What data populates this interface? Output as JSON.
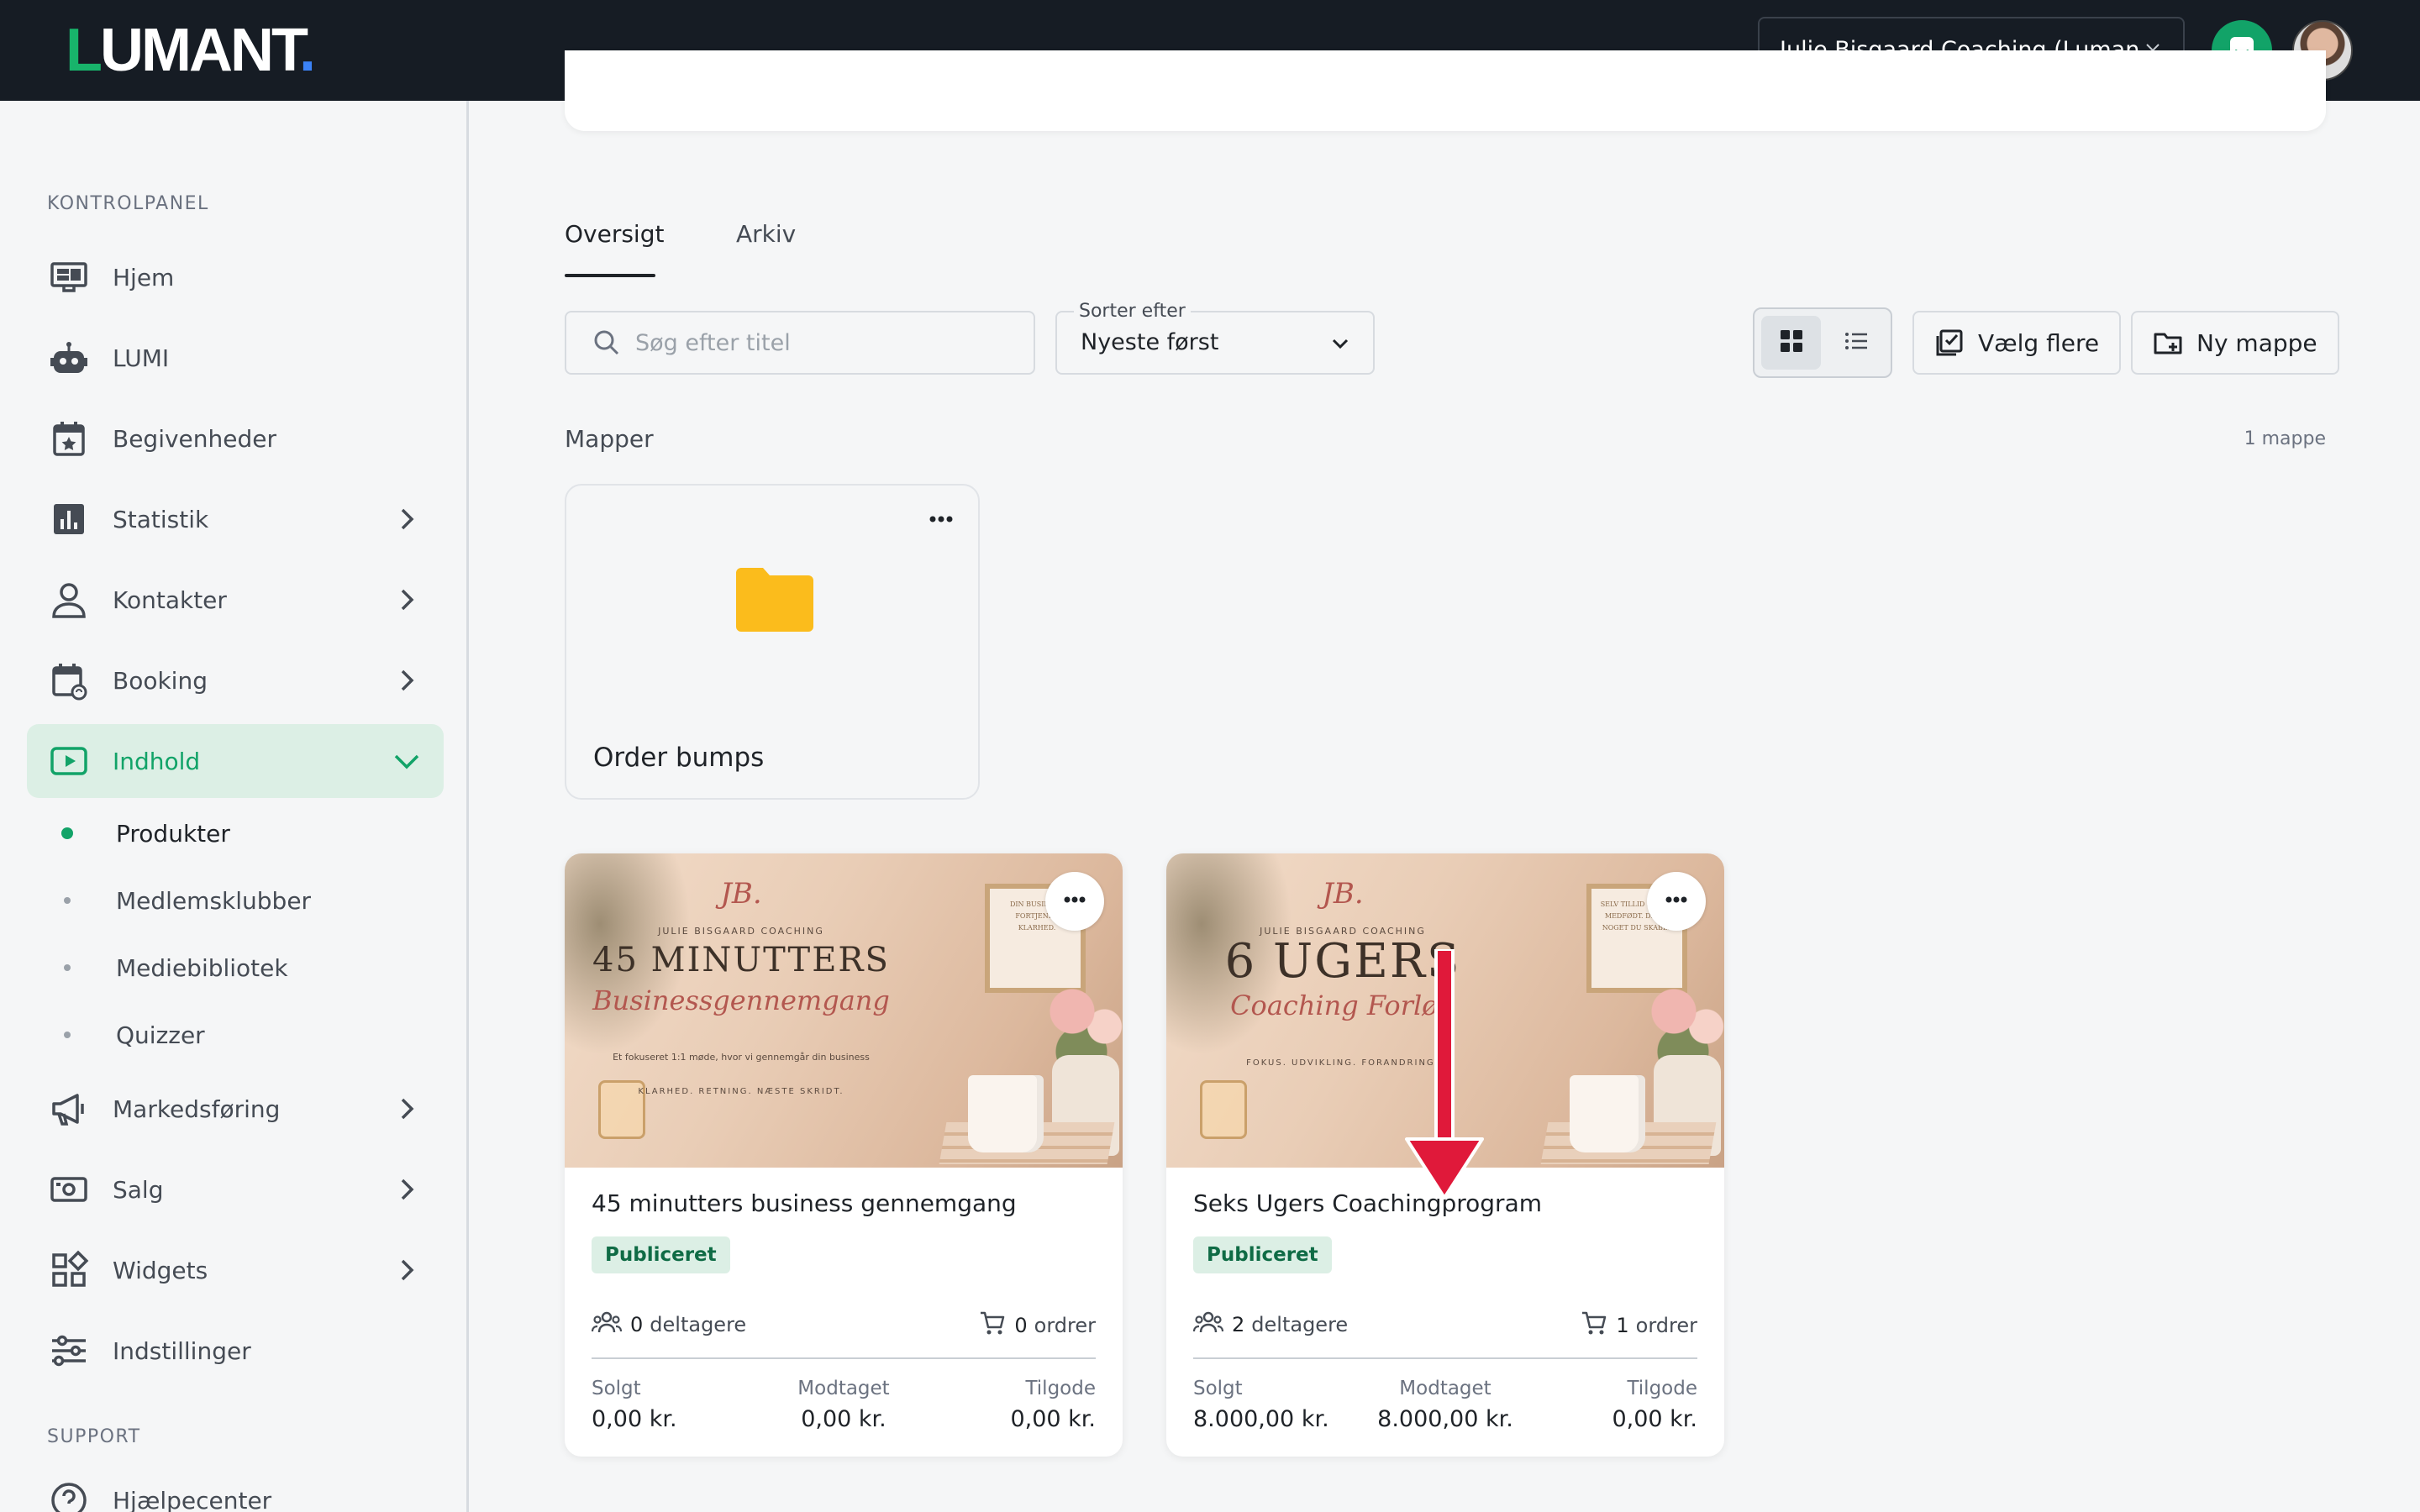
{
  "topbar": {
    "logo": {
      "first": "L",
      "rest": "UMANT",
      "dot": "."
    },
    "account": "Julie Bisgaard Coaching (Luman...",
    "colors": {
      "bg": "#161c24",
      "accent": "#12a368"
    }
  },
  "sidebar": {
    "section_main": "KONTROLPANEL",
    "section_support": "SUPPORT",
    "items": [
      {
        "label": "Hjem",
        "icon": "monitor-icon",
        "chevron": false
      },
      {
        "label": "LUMI",
        "icon": "robot-icon",
        "chevron": false
      },
      {
        "label": "Begivenheder",
        "icon": "calendar-star-icon",
        "chevron": false
      },
      {
        "label": "Statistik",
        "icon": "bar-chart-icon",
        "chevron": true
      },
      {
        "label": "Kontakter",
        "icon": "user-icon",
        "chevron": true
      },
      {
        "label": "Booking",
        "icon": "calendar-sync-icon",
        "chevron": true
      },
      {
        "label": "Indhold",
        "icon": "play-icon",
        "chevron": true,
        "active": true
      },
      {
        "label": "Markedsføring",
        "icon": "megaphone-icon",
        "chevron": true
      },
      {
        "label": "Salg",
        "icon": "cash-icon",
        "chevron": true
      },
      {
        "label": "Widgets",
        "icon": "widgets-icon",
        "chevron": true
      },
      {
        "label": "Indstillinger",
        "icon": "sliders-icon",
        "chevron": false
      }
    ],
    "sub_items": [
      "Produkter",
      "Medlemsklubber",
      "Mediebibliotek",
      "Quizzer"
    ],
    "support_item": "Hjælpecenter"
  },
  "main": {
    "tabs": [
      "Oversigt",
      "Arkiv"
    ],
    "search_placeholder": "Søg efter titel",
    "sort": {
      "label": "Sorter efter",
      "value": "Nyeste først"
    },
    "buttons": {
      "select_multiple": "Vælg flere",
      "new_folder": "Ny mappe"
    },
    "folders_label": "Mapper",
    "folders_count": "1 mappe",
    "folder": {
      "name": "Order bumps",
      "color": "#fbbc1c"
    },
    "products": [
      {
        "title": "45 minutters business gennemgang",
        "status": "Publiceret",
        "participants_n": "0",
        "participants_label": "deltagere",
        "orders_n": "0",
        "orders_label": "ordrer",
        "sold_label": "Solgt",
        "sold": "0,00 kr.",
        "received_label": "Modtaget",
        "received": "0,00 kr.",
        "due_label": "Tilgode",
        "due": "0,00 kr.",
        "thumb": {
          "monogram": "JB.",
          "brand": "JULIE BISGAARD COACHING",
          "headline": "45 MINUTTERS",
          "script": "Businessgennemgang",
          "tagline": "Et fokuseret 1:1 møde, hvor vi gennemgår din business",
          "tagline2": "KLARHED. RETNING. NÆSTE SKRIDT.",
          "frame": "DIN BUSINESS FORTJENER KLARHED."
        }
      },
      {
        "title": "Seks Ugers Coachingprogram",
        "status": "Publiceret",
        "participants_n": "2",
        "participants_label": "deltagere",
        "orders_n": "1",
        "orders_label": "ordrer",
        "sold_label": "Solgt",
        "sold": "8.000,00 kr.",
        "received_label": "Modtaget",
        "received": "8.000,00 kr.",
        "due_label": "Tilgode",
        "due": "0,00 kr.",
        "thumb": {
          "monogram": "JB.",
          "brand": "JULIE BISGAARD COACHING",
          "headline": "6 UGERS",
          "script": "Coaching Forløb",
          "tagline": "",
          "tagline2": "FOKUS. UDVIKLING. FORANDRING.",
          "frame": "SELV TILLID ER IKKE MEDFØDT. DET ER NOGET DU SKABER."
        }
      }
    ],
    "annotation_arrow_color": "#e0193a"
  }
}
